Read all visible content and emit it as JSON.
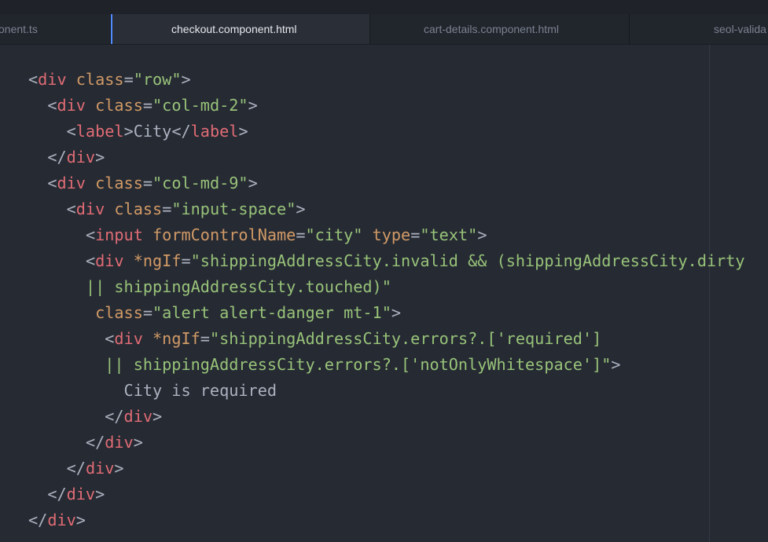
{
  "tabs": [
    {
      "label": "onent.ts",
      "active": false
    },
    {
      "label": "checkout.component.html",
      "active": true
    },
    {
      "label": "cart-details.component.html",
      "active": false
    },
    {
      "label": "seol-valida",
      "active": false
    }
  ],
  "code_lines": [
    [
      [
        "p",
        "<"
      ],
      [
        "t",
        "div"
      ],
      [
        "x",
        " "
      ],
      [
        "a",
        "class"
      ],
      [
        "p",
        "="
      ],
      [
        "s",
        "\"row\""
      ],
      [
        "p",
        ">"
      ]
    ],
    [
      [
        "x",
        "  "
      ],
      [
        "p",
        "<"
      ],
      [
        "t",
        "div"
      ],
      [
        "x",
        " "
      ],
      [
        "a",
        "class"
      ],
      [
        "p",
        "="
      ],
      [
        "s",
        "\"col-md-2\""
      ],
      [
        "p",
        ">"
      ]
    ],
    [
      [
        "x",
        "    "
      ],
      [
        "p",
        "<"
      ],
      [
        "t",
        "label"
      ],
      [
        "p",
        ">"
      ],
      [
        "x",
        "City"
      ],
      [
        "p",
        "</"
      ],
      [
        "t",
        "label"
      ],
      [
        "p",
        ">"
      ]
    ],
    [
      [
        "x",
        "  "
      ],
      [
        "p",
        "</"
      ],
      [
        "t",
        "div"
      ],
      [
        "p",
        ">"
      ]
    ],
    [
      [
        "x",
        "  "
      ],
      [
        "p",
        "<"
      ],
      [
        "t",
        "div"
      ],
      [
        "x",
        " "
      ],
      [
        "a",
        "class"
      ],
      [
        "p",
        "="
      ],
      [
        "s",
        "\"col-md-9\""
      ],
      [
        "p",
        ">"
      ]
    ],
    [
      [
        "x",
        "    "
      ],
      [
        "p",
        "<"
      ],
      [
        "t",
        "div"
      ],
      [
        "x",
        " "
      ],
      [
        "a",
        "class"
      ],
      [
        "p",
        "="
      ],
      [
        "s",
        "\"input-space\""
      ],
      [
        "p",
        ">"
      ]
    ],
    [
      [
        "x",
        "      "
      ],
      [
        "p",
        "<"
      ],
      [
        "t",
        "input"
      ],
      [
        "x",
        " "
      ],
      [
        "a",
        "formControlName"
      ],
      [
        "p",
        "="
      ],
      [
        "s",
        "\"city\""
      ],
      [
        "x",
        " "
      ],
      [
        "a",
        "type"
      ],
      [
        "p",
        "="
      ],
      [
        "s",
        "\"text\""
      ],
      [
        "p",
        ">"
      ]
    ],
    [
      [
        "x",
        "      "
      ],
      [
        "p",
        "<"
      ],
      [
        "t",
        "div"
      ],
      [
        "x",
        " "
      ],
      [
        "a",
        "*ngIf"
      ],
      [
        "p",
        "="
      ],
      [
        "s",
        "\"shippingAddressCity.invalid && (shippingAddressCity.dirty"
      ]
    ],
    [
      [
        "x",
        "      "
      ],
      [
        "s",
        "|| shippingAddressCity.touched)\""
      ]
    ],
    [
      [
        "x",
        "       "
      ],
      [
        "a",
        "class"
      ],
      [
        "p",
        "="
      ],
      [
        "s",
        "\"alert alert-danger mt-1\""
      ],
      [
        "p",
        ">"
      ]
    ],
    [
      [
        "x",
        "        "
      ],
      [
        "p",
        "<"
      ],
      [
        "t",
        "div"
      ],
      [
        "x",
        " "
      ],
      [
        "a",
        "*ngIf"
      ],
      [
        "p",
        "="
      ],
      [
        "s",
        "\"shippingAddressCity.errors?.['required']"
      ]
    ],
    [
      [
        "x",
        "        "
      ],
      [
        "s",
        "|| shippingAddressCity.errors?.['notOnlyWhitespace']\""
      ],
      [
        "p",
        ">"
      ]
    ],
    [
      [
        "x",
        "          City is required"
      ]
    ],
    [
      [
        "x",
        "        "
      ],
      [
        "p",
        "</"
      ],
      [
        "t",
        "div"
      ],
      [
        "p",
        ">"
      ]
    ],
    [
      [
        "x",
        "      "
      ],
      [
        "p",
        "</"
      ],
      [
        "t",
        "div"
      ],
      [
        "p",
        ">"
      ]
    ],
    [
      [
        "x",
        "    "
      ],
      [
        "p",
        "</"
      ],
      [
        "t",
        "div"
      ],
      [
        "p",
        ">"
      ]
    ],
    [
      [
        "x",
        "  "
      ],
      [
        "p",
        "</"
      ],
      [
        "t",
        "div"
      ],
      [
        "p",
        ">"
      ]
    ],
    [
      [
        "p",
        "</"
      ],
      [
        "t",
        "div"
      ],
      [
        "p",
        ">"
      ]
    ]
  ]
}
